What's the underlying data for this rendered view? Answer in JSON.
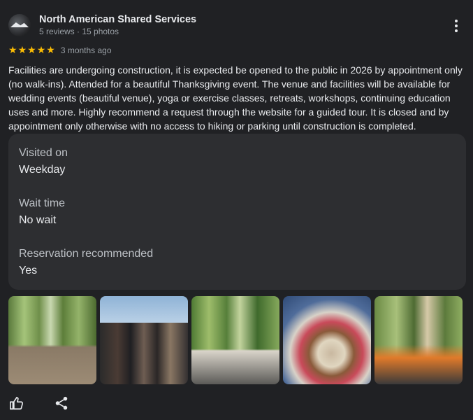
{
  "reviewer": {
    "name": "North American Shared Services",
    "meta": "5 reviews · 15 photos",
    "avatar_icon": "logo-avatar"
  },
  "rating": {
    "stars": 5,
    "max": 5,
    "star_color": "#fbbc04",
    "date": "3 months ago"
  },
  "review": {
    "text": "Facilities are undergoing construction, it is expected be opened to the public in 2026 by appointment only (no walk-ins). Attended for a beautiful Thanksgiving event. The venue and facilities will be available for wedding events (beautiful venue), yoga or exercise classes, retreats, workshops, continuing education uses and more. Highly recommend a request through the website for a guided tour. It is closed and by appointment only otherwise with no access to hiking or parking until construction is completed."
  },
  "details": [
    {
      "key": "Visited on",
      "value": "Weekday"
    },
    {
      "key": "Wait time",
      "value": "No wait"
    },
    {
      "key": "Reservation recommended",
      "value": "Yes"
    }
  ],
  "photos": [
    {
      "icon": "photo-construction-site"
    },
    {
      "icon": "photo-group-hikers"
    },
    {
      "icon": "photo-outdoor-dinner-table"
    },
    {
      "icon": "photo-food-plate"
    },
    {
      "icon": "photo-outdoor-gathering"
    }
  ],
  "actions": {
    "like_icon": "thumbs-up-icon",
    "share_icon": "share-icon",
    "more_icon": "more-vertical-icon"
  },
  "colors": {
    "background": "#202124",
    "card": "#2d2e31",
    "text": "#e8eaed",
    "muted": "#9aa0a6"
  }
}
